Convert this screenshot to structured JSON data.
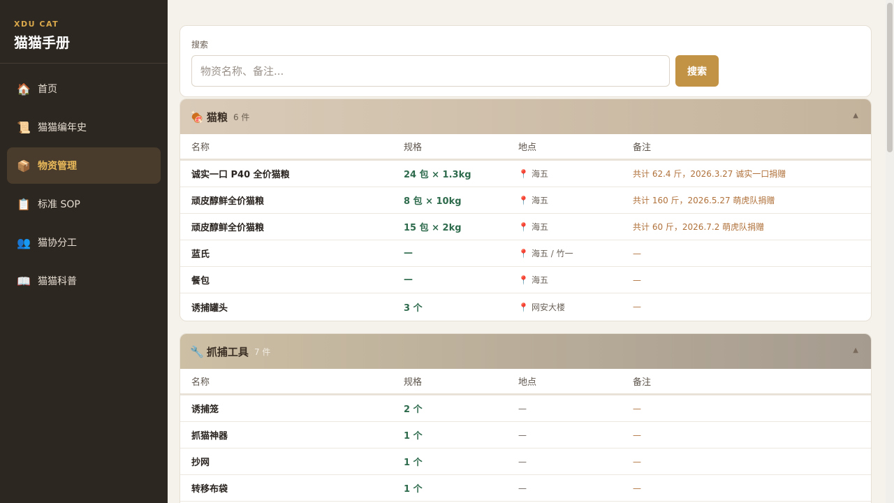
{
  "brand": {
    "sub": "XDU CAT",
    "title": "猫猫手册"
  },
  "nav": [
    {
      "icon": "🏠",
      "label": "首页",
      "active": false
    },
    {
      "icon": "📜",
      "label": "猫猫编年史",
      "active": false
    },
    {
      "icon": "📦",
      "label": "物资管理",
      "active": true
    },
    {
      "icon": "📋",
      "label": "标准 SOP",
      "active": false
    },
    {
      "icon": "👥",
      "label": "猫协分工",
      "active": false
    },
    {
      "icon": "📖",
      "label": "猫猫科普",
      "active": false
    }
  ],
  "search": {
    "label": "搜索",
    "placeholder": "物资名称、备注...",
    "button": "搜索"
  },
  "table_headers": {
    "name": "名称",
    "spec": "规格",
    "location": "地点",
    "note": "备注"
  },
  "sections": [
    {
      "icon": "🍖",
      "title": "猫粮",
      "count": "6 件",
      "toggle": "▲",
      "rows": [
        {
          "name": "诚实一口 P40 全价猫粮",
          "spec": "24 包 × 1.3kg",
          "location": "海五",
          "note": "共计 62.4 斤，2026.3.27 诚实一口捐赠"
        },
        {
          "name": "顽皮醇鲜全价猫粮",
          "spec": "8 包 × 10kg",
          "location": "海五",
          "note": "共计 160 斤，2026.5.27 萌虎队捐赠"
        },
        {
          "name": "顽皮醇鲜全价猫粮",
          "spec": "15 包 × 2kg",
          "location": "海五",
          "note": "共计 60 斤，2026.7.2 萌虎队捐赠"
        },
        {
          "name": "蓝氏",
          "spec": "—",
          "location": "海五 / 竹一",
          "note": "—"
        },
        {
          "name": "餐包",
          "spec": "—",
          "location": "海五",
          "note": "—"
        },
        {
          "name": "诱捕罐头",
          "spec": "3 个",
          "location": "网安大楼",
          "note": "—"
        }
      ]
    },
    {
      "icon": "🔧",
      "title": "抓捕工具",
      "count": "7 件",
      "toggle": "▲",
      "rows": [
        {
          "name": "诱捕笼",
          "spec": "2 个",
          "location": "—",
          "note": "—"
        },
        {
          "name": "抓猫神器",
          "spec": "1 个",
          "location": "—",
          "note": "—"
        },
        {
          "name": "抄网",
          "spec": "1 个",
          "location": "—",
          "note": "—"
        },
        {
          "name": "转移布袋",
          "spec": "1 个",
          "location": "—",
          "note": "—"
        }
      ]
    }
  ]
}
